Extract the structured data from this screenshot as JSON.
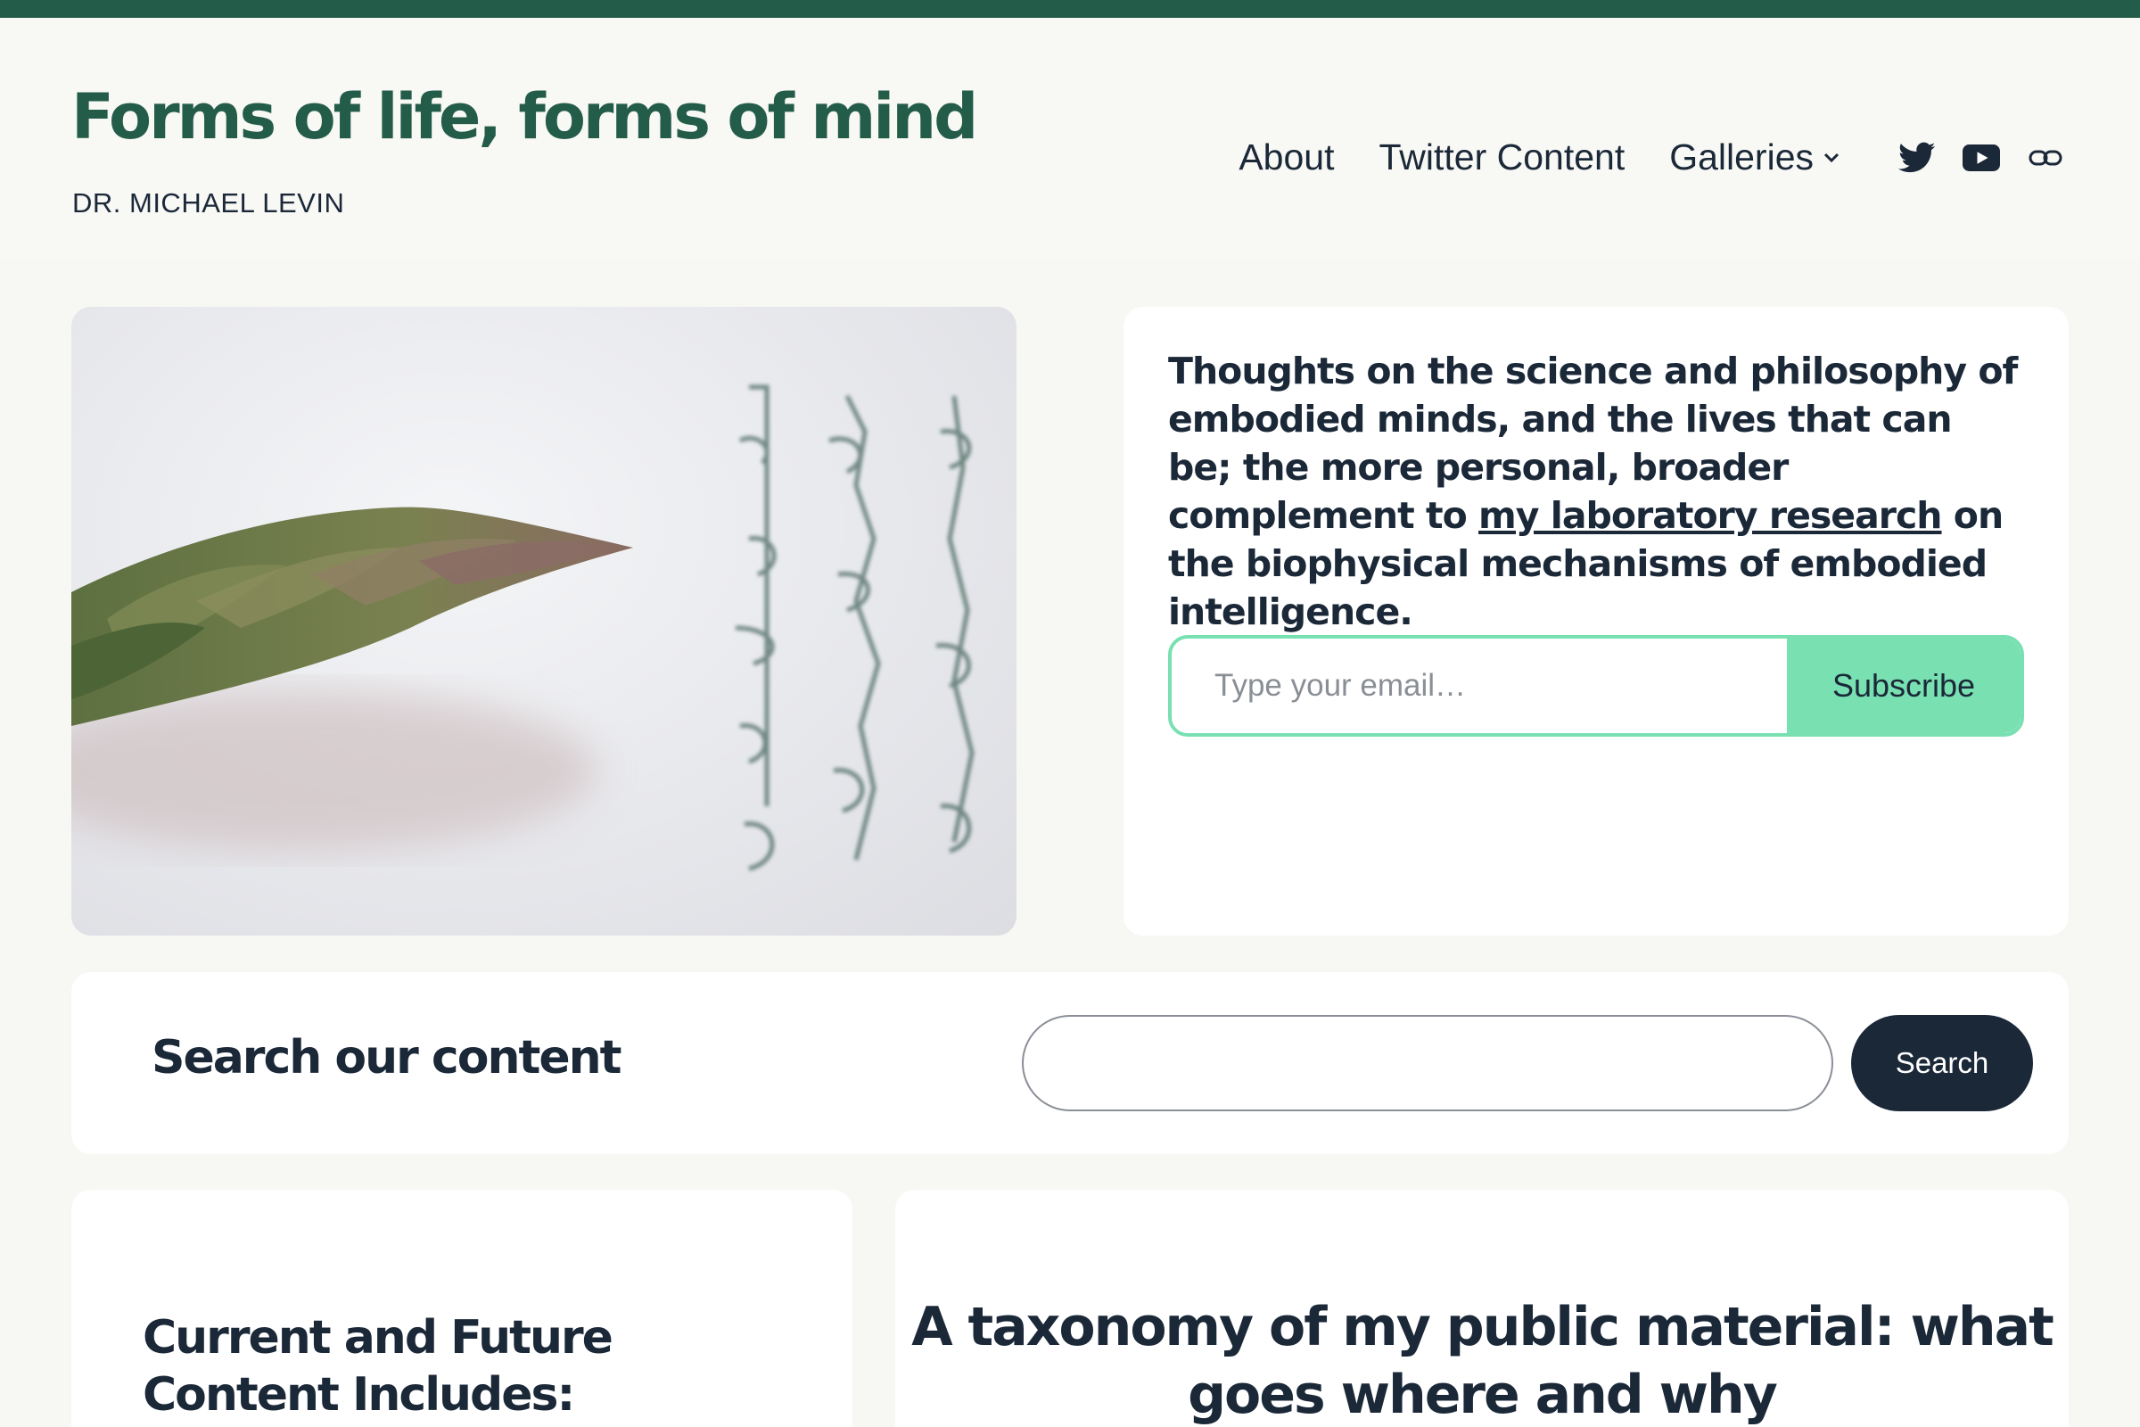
{
  "header": {
    "site_title": "Forms of life, forms of mind",
    "site_subtitle": "DR. MICHAEL LEVIN",
    "nav": [
      {
        "label": "About"
      },
      {
        "label": "Twitter Content"
      },
      {
        "label": "Galleries"
      }
    ],
    "social_icons": [
      "twitter-icon",
      "youtube-icon",
      "link-icon"
    ]
  },
  "hero": {
    "image_subject": "asparagus tip with handwritten equations",
    "intro_before_link": "Thoughts on the science and philosophy of embodied minds, and the lives that can be; the more personal, broader complement to ",
    "intro_link": "my laboratory research",
    "intro_after_link": " on the biophysical mechanisms of embodied intelligence.",
    "email_placeholder": "Type your email…",
    "subscribe_label": "Subscribe"
  },
  "search": {
    "title": "Search our content",
    "input_value": "",
    "button_label": "Search"
  },
  "cards": {
    "left_heading": "Current and Future Content Includes:",
    "right_heading": "A taxonomy of my public material: what goes where and why"
  },
  "colors": {
    "brand_green": "#245c4a",
    "accent_mint": "#79e0b2",
    "navy": "#1b2838",
    "page_bg": "#f7f7f4"
  }
}
